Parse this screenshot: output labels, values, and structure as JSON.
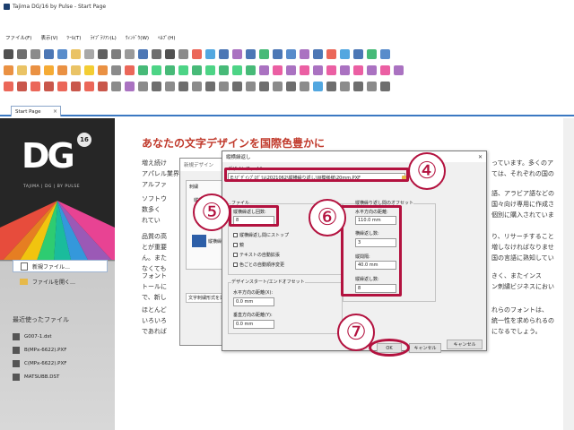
{
  "window": {
    "title": "Tajima DG/16 by Pulse - Start Page"
  },
  "menu": [
    "ファイル(F)",
    "表示(V)",
    "ﾂｰﾙ(T)",
    "ﾗｲﾌﾞﾗﾘｱﾝ(L)",
    "ｳｨﾝﾄﾞｳ(W)",
    "ﾍﾙﾌﾟ(H)"
  ],
  "tab": {
    "label": "Start Page",
    "close": "×"
  },
  "left": {
    "logo": "DG",
    "badge": "16",
    "logo_sub": "TAJIMA | DG | BY PULSE",
    "new_file": "新規ファイル…",
    "open_file": "ファイルを開く…",
    "recent_title": "最近使ったファイル",
    "recent": [
      "G007-1.dst",
      "B(MPx-6622).PXF",
      "C(MPx-6622).PXF",
      "MATSUBB.DST"
    ]
  },
  "main": {
    "heading": "あなたの文字デザインを国際色豊かに",
    "p1": [
      "増え続け",
      "アパレル業界",
      "アルファ"
    ],
    "p1_right": [
      "っています。多くのア",
      "ては、それぞれの国の"
    ],
    "p2": [
      "ソフトウ",
      "数多く",
      "れてい"
    ],
    "p2_right": [
      "語、アラビア語などの",
      "国々向け専用に作成さ",
      "個別に購入されていま"
    ],
    "p3": [
      "品質の高",
      "とが重要",
      "ん。また",
      "なくても"
    ],
    "p3_right": [
      "り、リサーチすること",
      "増しなければなりませ",
      "国の言語に熟知してい"
    ],
    "p4": [
      "フォント",
      "トールに",
      "で、新し"
    ],
    "p4_right": [
      "きく、またインス",
      "ン刺繍ビジネスにおい"
    ],
    "p5": [
      "ほとんど",
      "いろいろ",
      "であれば"
    ],
    "p5_right": [
      "れらのフォントは、",
      "統一性を求められるの",
      "になるでしょう。"
    ]
  },
  "back_dialog": {
    "title": "新規デザイン",
    "group": "刺繍",
    "item1": "縦横繰",
    "item2": "縦",
    "text_a": "縦横繰返",
    "text_b": "文字刺繍形式を選"
  },
  "dialog": {
    "title": "縦横繰返し",
    "close": "✕",
    "design_file_label": "デザインファイル:",
    "design_file_value": "E:\\ﾃﾞｻﾞｲﾝﾌﾟﾛｸﾞﾗﾑ\\2021062\\縦横繰り返し\\W模様様\\20mm.PXF",
    "file_group": "ファイル",
    "repeat_count_label": "縦横繰返し回数:",
    "repeat_count_value": "8",
    "checkboxes": [
      "縦横繰返し間にストップ",
      "鏡",
      "テキストの自動拡張",
      "色ごとの自動順序変更"
    ],
    "offset_group": "デザインスタート/エンドオフセット",
    "h_dist_label": "水平方向の距離(X):",
    "h_dist_value": "0.0 mm",
    "v_dist_label": "垂直方向の距離(Y):",
    "v_dist_value": "0.0 mm",
    "right_group": "縦横繰り返し間のオフセット",
    "right_h_label": "水平方向の距離:",
    "right_h_value": "110.0 mm",
    "right_count_label": "横繰返し数:",
    "right_count_value": "3",
    "right_v_label": "縦間隔:",
    "right_v_value": "40.0 mm",
    "right_vcount_label": "縦繰返し数:",
    "right_vcount_value": "8",
    "ok": "OK",
    "cancel": "キャンセル",
    "cancel2": "キャンセル"
  },
  "annotations": [
    "④",
    "⑤",
    "⑥",
    "⑦"
  ],
  "colors": {
    "highlight": "#b3123f",
    "heading": "#c0392b",
    "accent": "#3b78c2"
  }
}
